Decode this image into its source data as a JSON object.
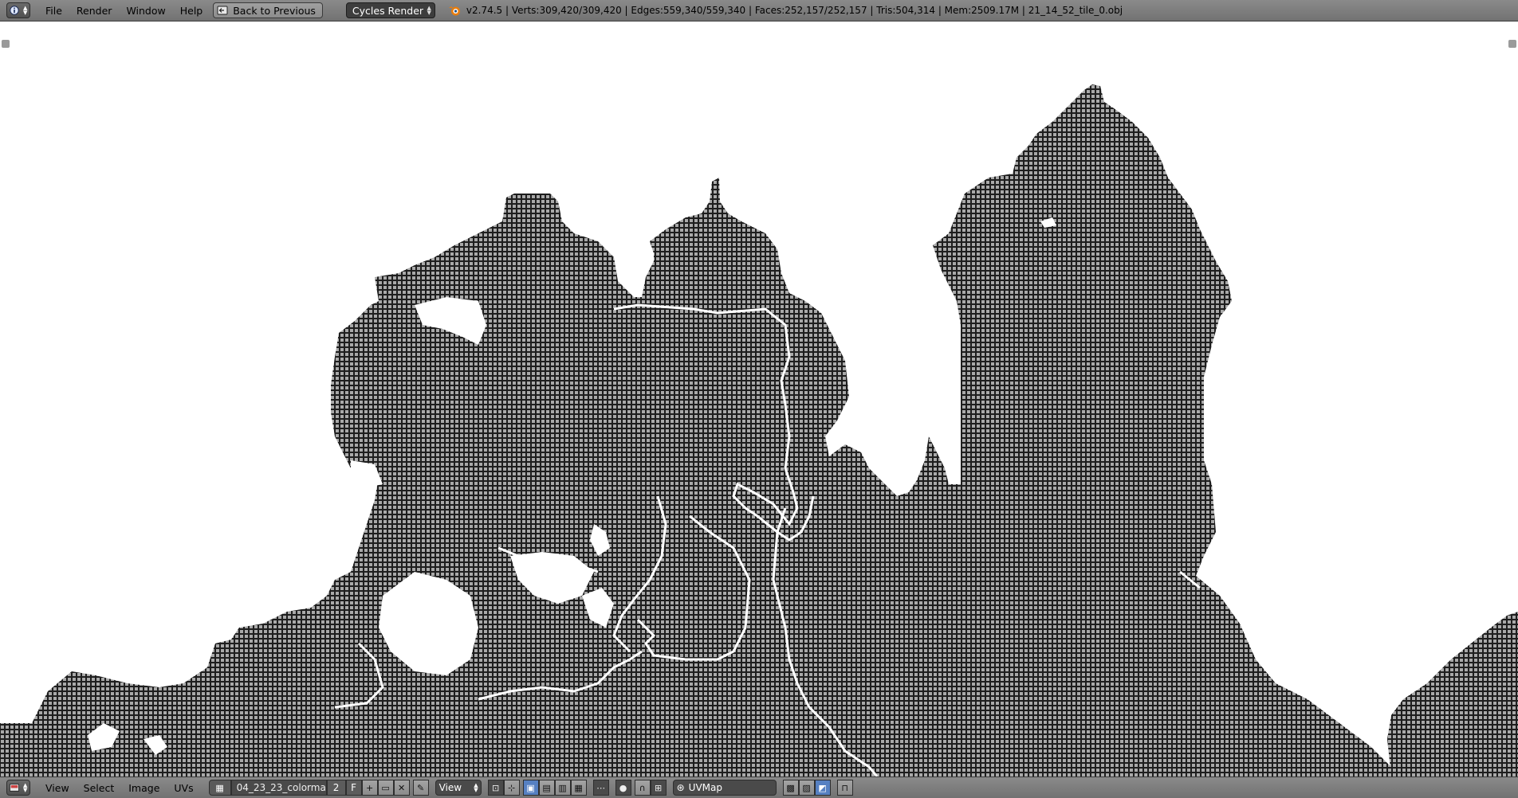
{
  "top_header": {
    "editor_type_icon": "info-icon",
    "menus": [
      "File",
      "Render",
      "Window",
      "Help"
    ],
    "back_button": {
      "label": "Back to Previous",
      "icon": "screen-back-icon"
    },
    "render_engine": "Cycles Render",
    "logo_icon": "blender-logo-icon",
    "stats": "v2.74.5 | Verts:309,420/309,420 | Edges:559,340/559,340 | Faces:252,157/252,157 | Tris:504,314 | Mem:2509.17M | 21_14_52_tile_0.obj"
  },
  "viewport": {
    "content": "uv-mesh-grid",
    "mesh_color": "#1e1e1e",
    "background_color": "#ffffff",
    "seam_color": "#ffffff"
  },
  "bottom_header": {
    "editor_type_icon": "image-editor-icon",
    "menus": [
      "View",
      "Select",
      "Image",
      "UVs"
    ],
    "image_name": "04_23_23_colorma...",
    "image_users": "2",
    "fake_user": "F",
    "view_mode": "View",
    "uv_map": "UVMap"
  },
  "colors": {
    "header_bg": "#7e7e7e",
    "accent_active": "#5680c2",
    "dark_widget": "#3d3d3d"
  }
}
